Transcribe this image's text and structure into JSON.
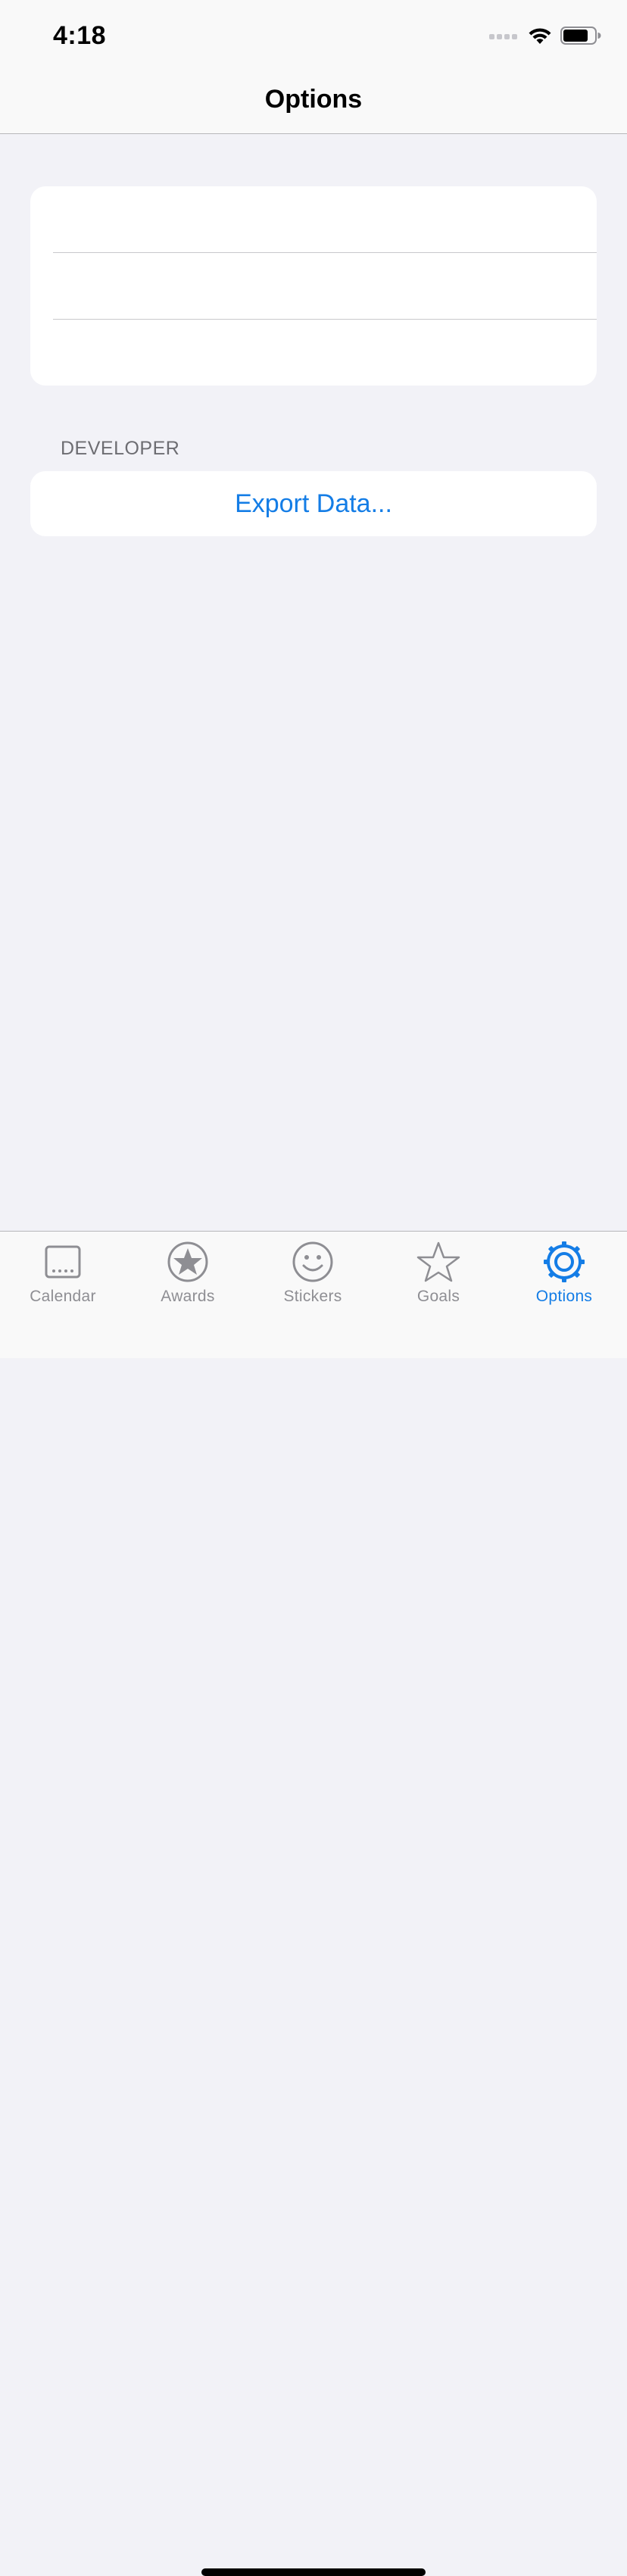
{
  "status_bar": {
    "time": "4:18"
  },
  "nav": {
    "title": "Options"
  },
  "sections": [
    {
      "header": "",
      "rows": [
        "",
        "",
        ""
      ]
    },
    {
      "header": "DEVELOPER",
      "rows": [
        "Export Data..."
      ]
    }
  ],
  "tab_bar": {
    "items": [
      {
        "label": "Calendar",
        "icon": "calendar-icon",
        "active": false
      },
      {
        "label": "Awards",
        "icon": "award-star-circle-icon",
        "active": false
      },
      {
        "label": "Stickers",
        "icon": "smiley-face-icon",
        "active": false
      },
      {
        "label": "Goals",
        "icon": "star-outline-icon",
        "active": false
      },
      {
        "label": "Options",
        "icon": "gear-icon",
        "active": true
      }
    ]
  },
  "colors": {
    "accent": "#147de6",
    "inactive": "#8e8e93",
    "background": "#f2f2f7",
    "card": "#ffffff",
    "section_header": "#6d6d72"
  }
}
